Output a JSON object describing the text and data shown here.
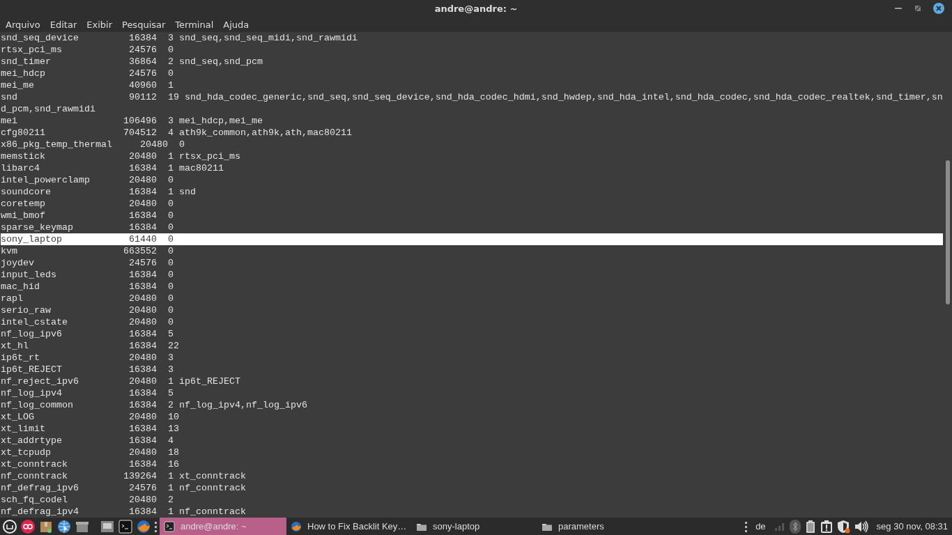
{
  "window": {
    "title": "andre@andre: ~"
  },
  "menu": [
    "Arquivo",
    "Editar",
    "Exibir",
    "Pesquisar",
    "Terminal",
    "Ajuda"
  ],
  "terminal": {
    "rows": [
      {
        "name": "snd_seq_device",
        "size": "16384",
        "used": "3",
        "by": "snd_seq,snd_seq_midi,snd_rawmidi",
        "selected": false
      },
      {
        "name": "rtsx_pci_ms",
        "size": "24576",
        "used": "0",
        "by": "",
        "selected": false
      },
      {
        "name": "snd_timer",
        "size": "36864",
        "used": "2",
        "by": "snd_seq,snd_pcm",
        "selected": false
      },
      {
        "name": "mei_hdcp",
        "size": "24576",
        "used": "0",
        "by": "",
        "selected": false
      },
      {
        "name": "mei_me",
        "size": "40960",
        "used": "1",
        "by": "",
        "selected": false
      },
      {
        "name": "snd",
        "size": "90112",
        "used": "19",
        "by": "snd_hda_codec_generic,snd_seq,snd_seq_device,snd_hda_codec_hdmi,snd_hwdep,snd_hda_intel,snd_hda_codec,snd_hda_codec_realtek,snd_timer,snd_pcm,snd_rawmidi",
        "selected": false
      },
      {
        "name": "mei",
        "size": "106496",
        "used": "3",
        "by": "mei_hdcp,mei_me",
        "selected": false
      },
      {
        "name": "cfg80211",
        "size": "704512",
        "used": "4",
        "by": "ath9k_common,ath9k,ath,mac80211",
        "selected": false
      },
      {
        "name": "x86_pkg_temp_thermal",
        "size": "20480",
        "used": "0",
        "by": "",
        "selected": false
      },
      {
        "name": "memstick",
        "size": "20480",
        "used": "1",
        "by": "rtsx_pci_ms",
        "selected": false
      },
      {
        "name": "libarc4",
        "size": "16384",
        "used": "1",
        "by": "mac80211",
        "selected": false
      },
      {
        "name": "intel_powerclamp",
        "size": "20480",
        "used": "0",
        "by": "",
        "selected": false
      },
      {
        "name": "soundcore",
        "size": "16384",
        "used": "1",
        "by": "snd",
        "selected": false
      },
      {
        "name": "coretemp",
        "size": "20480",
        "used": "0",
        "by": "",
        "selected": false
      },
      {
        "name": "wmi_bmof",
        "size": "16384",
        "used": "0",
        "by": "",
        "selected": false
      },
      {
        "name": "sparse_keymap",
        "size": "16384",
        "used": "0",
        "by": "",
        "selected": false
      },
      {
        "name": "sony_laptop",
        "size": "61440",
        "used": "0",
        "by": "",
        "selected": true
      },
      {
        "name": "kvm",
        "size": "663552",
        "used": "0",
        "by": "",
        "selected": false
      },
      {
        "name": "joydev",
        "size": "24576",
        "used": "0",
        "by": "",
        "selected": false
      },
      {
        "name": "input_leds",
        "size": "16384",
        "used": "0",
        "by": "",
        "selected": false
      },
      {
        "name": "mac_hid",
        "size": "16384",
        "used": "0",
        "by": "",
        "selected": false
      },
      {
        "name": "rapl",
        "size": "20480",
        "used": "0",
        "by": "",
        "selected": false
      },
      {
        "name": "serio_raw",
        "size": "20480",
        "used": "0",
        "by": "",
        "selected": false
      },
      {
        "name": "intel_cstate",
        "size": "20480",
        "used": "0",
        "by": "",
        "selected": false
      },
      {
        "name": "nf_log_ipv6",
        "size": "16384",
        "used": "5",
        "by": "",
        "selected": false
      },
      {
        "name": "xt_hl",
        "size": "16384",
        "used": "22",
        "by": "",
        "selected": false
      },
      {
        "name": "ip6t_rt",
        "size": "20480",
        "used": "3",
        "by": "",
        "selected": false
      },
      {
        "name": "ip6t_REJECT",
        "size": "16384",
        "used": "3",
        "by": "",
        "selected": false
      },
      {
        "name": "nf_reject_ipv6",
        "size": "20480",
        "used": "1",
        "by": "ip6t_REJECT",
        "selected": false
      },
      {
        "name": "nf_log_ipv4",
        "size": "16384",
        "used": "5",
        "by": "",
        "selected": false
      },
      {
        "name": "nf_log_common",
        "size": "16384",
        "used": "2",
        "by": "nf_log_ipv4,nf_log_ipv6",
        "selected": false
      },
      {
        "name": "xt_LOG",
        "size": "20480",
        "used": "10",
        "by": "",
        "selected": false
      },
      {
        "name": "xt_limit",
        "size": "16384",
        "used": "13",
        "by": "",
        "selected": false
      },
      {
        "name": "xt_addrtype",
        "size": "16384",
        "used": "4",
        "by": "",
        "selected": false
      },
      {
        "name": "xt_tcpudp",
        "size": "20480",
        "used": "18",
        "by": "",
        "selected": false
      },
      {
        "name": "xt_conntrack",
        "size": "16384",
        "used": "16",
        "by": "",
        "selected": false
      },
      {
        "name": "nf_conntrack",
        "size": "139264",
        "used": "1",
        "by": "xt_conntrack",
        "selected": false
      },
      {
        "name": "nf_defrag_ipv6",
        "size": "24576",
        "used": "1",
        "by": "nf_conntrack",
        "selected": false
      },
      {
        "name": "sch_fq_codel",
        "size": "20480",
        "used": "2",
        "by": "",
        "selected": false
      },
      {
        "name": "nf_defrag_ipv4",
        "size": "16384",
        "used": "1",
        "by": "nf_conntrack",
        "selected": false
      }
    ]
  },
  "taskbar": {
    "windows": [
      {
        "label": "andre@andre: ~",
        "kind": "terminal",
        "selected": true
      },
      {
        "label": "How to Fix Backlit Key…",
        "kind": "browser",
        "selected": false
      },
      {
        "label": "sony-laptop",
        "kind": "folder",
        "selected": false
      },
      {
        "label": "parameters",
        "kind": "folder",
        "selected": false
      }
    ],
    "keyboard_layout": "de",
    "clock": "seg 30 nov, 08:31"
  }
}
